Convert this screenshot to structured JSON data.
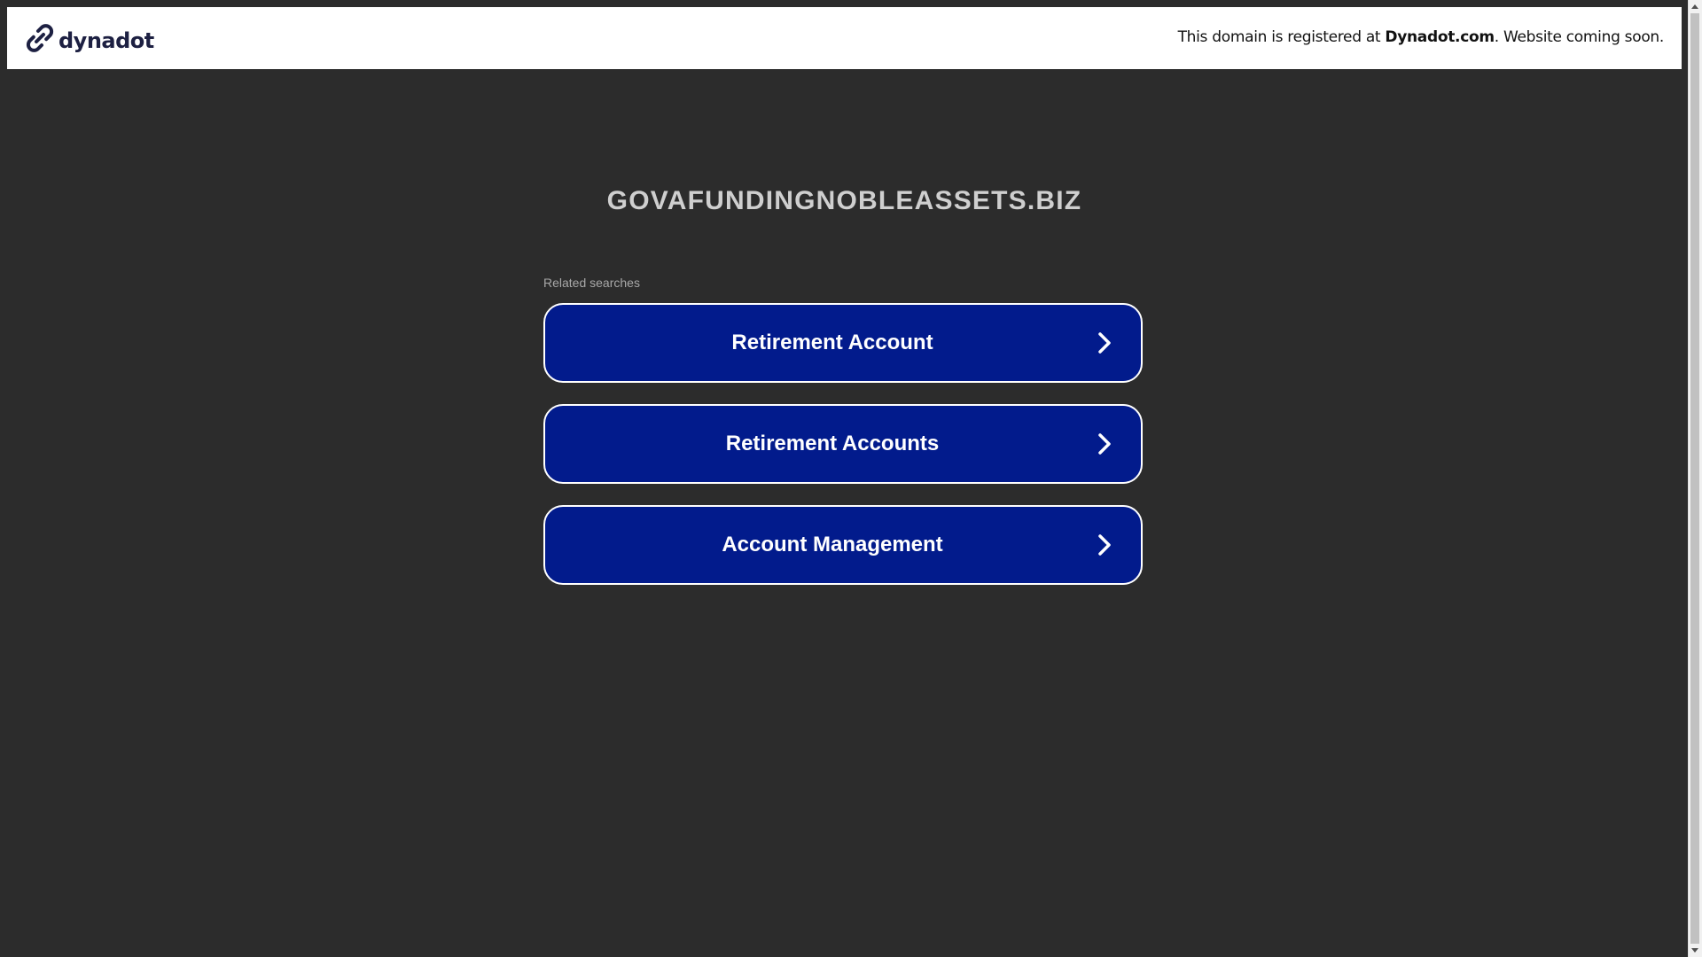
{
  "header": {
    "logo_text": "dynadot",
    "notice_prefix": "This domain is registered at ",
    "notice_brand": "Dynadot.com",
    "notice_suffix": ". Website coming soon."
  },
  "main": {
    "domain_name": "GOVAFUNDINGNOBLEASSETS.BIZ",
    "related_label": "Related searches",
    "searches": [
      {
        "label": "Retirement Account"
      },
      {
        "label": "Retirement Accounts"
      },
      {
        "label": "Account Management"
      }
    ]
  },
  "colors": {
    "background": "#2c2c2c",
    "button": "#021b8c",
    "logo": "#1d2042"
  },
  "icons": {
    "logo": "dynadot-link-logo-icon",
    "chevron": "chevron-right-icon"
  }
}
